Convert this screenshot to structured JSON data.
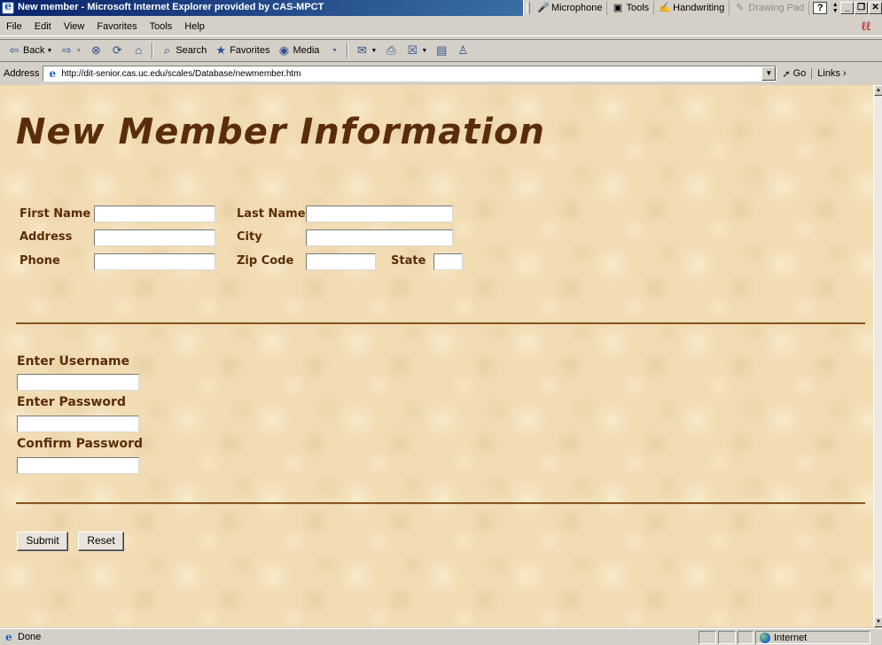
{
  "window": {
    "title": "New member - Microsoft Internet Explorer provided by CAS-MPCT"
  },
  "language_bar": {
    "items": [
      {
        "label": "Microphone",
        "icon": "microphone-icon"
      },
      {
        "label": "Tools",
        "icon": "tools-icon"
      },
      {
        "label": "Handwriting",
        "icon": "handwriting-icon"
      },
      {
        "label": "Drawing Pad",
        "icon": "drawing-pad-icon"
      }
    ],
    "help": "?"
  },
  "menu": {
    "items": [
      "File",
      "Edit",
      "View",
      "Favorites",
      "Tools",
      "Help"
    ]
  },
  "toolbar": {
    "back": "Back",
    "search": "Search",
    "favorites": "Favorites",
    "media": "Media"
  },
  "address": {
    "label": "Address",
    "url": "http://dit-senior.cas.uc.edu/scales/Database/newmember.htm",
    "go": "Go",
    "links": "Links"
  },
  "page": {
    "title": "New Member Information",
    "fields": {
      "first_name": "First Name",
      "last_name": "Last Name",
      "address": "Address",
      "city": "City",
      "phone": "Phone",
      "zip_code": "Zip Code",
      "state": "State"
    },
    "account": {
      "username": "Enter Username",
      "password": "Enter Password",
      "confirm": "Confirm Password"
    },
    "buttons": {
      "submit": "Submit",
      "reset": "Reset"
    }
  },
  "status": {
    "text": "Done",
    "zone": "Internet"
  },
  "colors": {
    "text_brown": "#5a2d08",
    "parchment": "#f1dcb4",
    "title_bar": "#0a246a"
  }
}
